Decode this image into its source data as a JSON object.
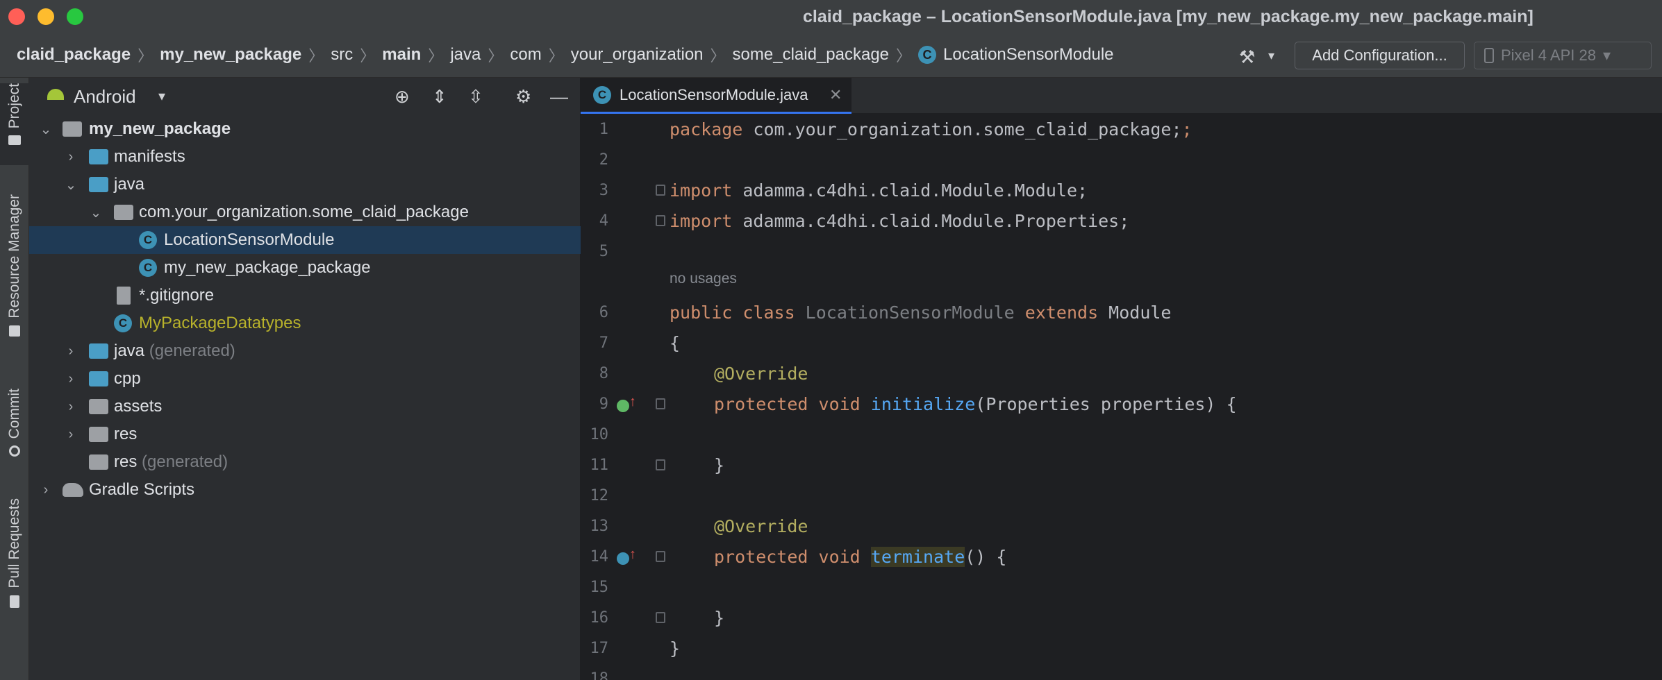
{
  "window": {
    "title": "claid_package – LocationSensorModule.java [my_new_package.my_new_package.main]"
  },
  "breadcrumbs": [
    "claid_package",
    "my_new_package",
    "src",
    "main",
    "java",
    "com",
    "your_organization",
    "some_claid_package",
    "LocationSensorModule"
  ],
  "toolbar": {
    "config_label": "Add Configuration...",
    "device_label": "Pixel 4 API 28"
  },
  "tool_windows": {
    "project": "Project",
    "resource_manager": "Resource Manager",
    "commit": "Commit",
    "pull_requests": "Pull Requests"
  },
  "project_panel": {
    "view_mode": "Android",
    "tree": [
      {
        "label": "my_new_package",
        "suffix": ""
      },
      {
        "label": "manifests",
        "suffix": ""
      },
      {
        "label": "java",
        "suffix": ""
      },
      {
        "label": "com.your_organization.some_claid_package",
        "suffix": ""
      },
      {
        "label": "LocationSensorModule",
        "suffix": ""
      },
      {
        "label": "my_new_package_package",
        "suffix": ""
      },
      {
        "label": "*.gitignore",
        "suffix": ""
      },
      {
        "label": "MyPackageDatatypes",
        "suffix": ""
      },
      {
        "label": "java",
        "suffix": "(generated)"
      },
      {
        "label": "cpp",
        "suffix": ""
      },
      {
        "label": "assets",
        "suffix": ""
      },
      {
        "label": "res",
        "suffix": ""
      },
      {
        "label": "res",
        "suffix": "(generated)"
      },
      {
        "label": "Gradle Scripts",
        "suffix": ""
      }
    ]
  },
  "editor": {
    "tab_label": "LocationSensorModule.java",
    "line_numbers": [
      "1",
      "2",
      "3",
      "4",
      "5",
      "6",
      "7",
      "8",
      "9",
      "10",
      "11",
      "12",
      "13",
      "14",
      "15",
      "16",
      "17",
      "18"
    ],
    "inlay_hint": "no usages",
    "lines": {
      "l1_kw": "package",
      "l1_rest": " com.your_organization.some_claid_package;",
      "l3_kw": "import",
      "l3_rest": " adamma.c4dhi.claid.Module.Module;",
      "l4_kw": "import",
      "l4_rest": " adamma.c4dhi.claid.Module.Properties;",
      "l6_kw1": "public class",
      "l6_cls": " LocationSensorModule ",
      "l6_kw2": "extends",
      "l6_rest": " Module",
      "l7": "{",
      "l8_ann": "@Override",
      "l9_kw": "protected void",
      "l9_fn": "initialize",
      "l9_rest": "(Properties properties) {",
      "l11": "}",
      "l13_ann": "@Override",
      "l14_kw": "protected void",
      "l14_fn": "terminate",
      "l14_rest": "() {",
      "l16": "}",
      "l17": "}"
    }
  }
}
